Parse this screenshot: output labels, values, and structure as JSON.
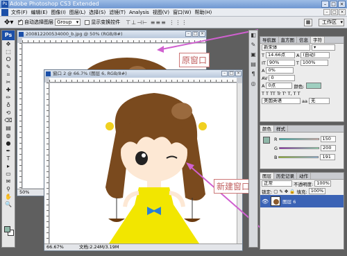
{
  "app": {
    "title": "Adobe Photoshop CS3 Extended",
    "logo": "Ps"
  },
  "menu": {
    "items": [
      "文件(F)",
      "编辑(E)",
      "图像(I)",
      "图层(L)",
      "选择(S)",
      "滤镜(T)",
      "Analysis",
      "视图(V)",
      "窗口(W)",
      "帮助(H)"
    ]
  },
  "options": {
    "auto_select_label": "自动选择图层",
    "auto_select_value": "Group",
    "transform_label": "显示变换控件",
    "workspace_label": "工作区"
  },
  "toolbox": {
    "header": "Ps",
    "tools": [
      "move-tool-icon",
      "marquee-tool-icon",
      "lasso-tool-icon",
      "quick-select-tool-icon",
      "crop-tool-icon",
      "slice-tool-icon",
      "healing-tool-icon",
      "brush-tool-icon",
      "stamp-tool-icon",
      "history-brush-icon",
      "eraser-tool-icon",
      "gradient-tool-icon",
      "blur-tool-icon",
      "dodge-tool-icon",
      "pen-tool-icon",
      "type-tool-icon",
      "path-select-icon",
      "shape-tool-icon",
      "notes-tool-icon",
      "eyedropper-tool-icon",
      "hand-tool-icon",
      "zoom-tool-icon"
    ],
    "tool_glyphs": [
      "✥",
      "⬚",
      "ⵔ",
      "✎",
      "⌗",
      "✂",
      "✚",
      "✏",
      "♁",
      "⟲",
      "⌫",
      "▤",
      "◍",
      "●",
      "✒",
      "T",
      "▸",
      "▭",
      "✉",
      "⚲",
      "✋",
      "🔍"
    ],
    "fg_color": "#8fb7a8",
    "bg_color": "#ffffff"
  },
  "doc1": {
    "title": "200812200534000_b.jpg @ 50% (RGB/8#)",
    "zoom": "50%"
  },
  "doc2": {
    "title": "窗口 2 @ 66.7% (RGB/8#)",
    "title_left": "窗口 2 @ 66.7% (图层 6, RGB/8#)",
    "zoom": "66.67%",
    "doc_size": "文档:2.24M/3.19M"
  },
  "callouts": {
    "original": "原窗口",
    "new": "新建窗口"
  },
  "character_panel": {
    "tabs": [
      "导航器",
      "直方图",
      "信息",
      "字符"
    ],
    "font_family": "新宋体",
    "font_size": "14.66点",
    "leading": "(自动)",
    "vertical_scale": "90%",
    "horizontal_scale": "100%",
    "tracking": "0%",
    "kerning": "0",
    "baseline": "0点",
    "color_label": "颜色:",
    "language": "美国英语",
    "aa_label": "aa",
    "aa_value": "无"
  },
  "color_panel": {
    "tabs": [
      "颜色",
      "样式"
    ],
    "r_label": "R",
    "g_label": "G",
    "b_label": "B",
    "r_value": "150",
    "g_value": "200",
    "b_value": "191",
    "chip_color": "#8fb7a8"
  },
  "layers_panel": {
    "tabs": [
      "图层",
      "历史记录",
      "动作"
    ],
    "blend_mode": "正常",
    "opacity_label": "不透明度:",
    "opacity_value": "100%",
    "lock_label": "锁定:",
    "fill_label": "填充:",
    "fill_value": "100%",
    "layer_name": "图层 6"
  },
  "colors": {
    "hair": "#7a4a1e",
    "skin": "#fde8d4",
    "dress": "#f2e600",
    "bow": "#2a7fd4",
    "hair_tie": "#f0d020",
    "arrow": "#d060d0",
    "selected_layer": "#3b63b5"
  }
}
